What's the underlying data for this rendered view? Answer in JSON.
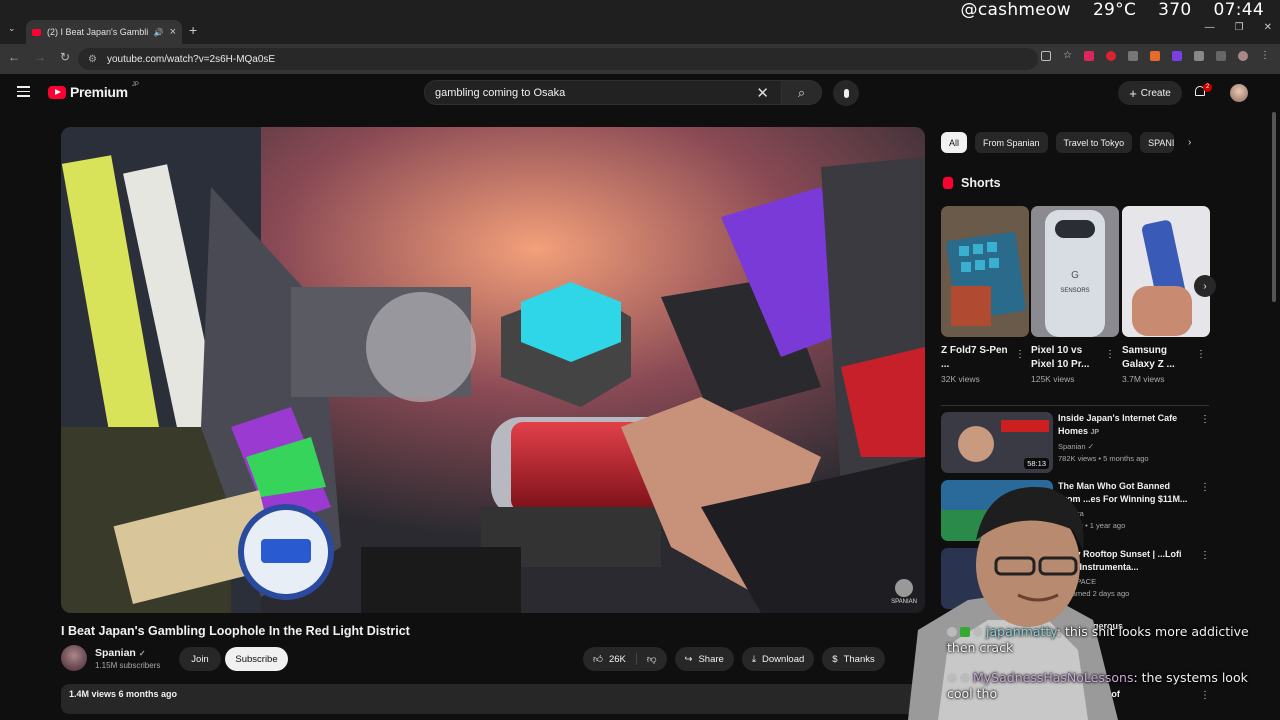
{
  "overlay": {
    "handle": "@cashmeow",
    "temp": "29°C",
    "count": "370",
    "clock": "07:44"
  },
  "browser": {
    "tab_title": "(2) I Beat Japan's Gambling",
    "url": "youtube.com/watch?v=2s6H-MQa0sE"
  },
  "header": {
    "logo_text": "Premium",
    "logo_region": "JP",
    "search_query": "gambling coming to Osaka",
    "create_label": "Create",
    "notif_count": "2"
  },
  "video": {
    "title": "I Beat Japan's Gambling Loophole In the Red Light District",
    "channel": "Spanian",
    "subscribers": "1.15M subscribers",
    "join_label": "Join",
    "subscribe_label": "Subscribe",
    "likes": "26K",
    "share_label": "Share",
    "download_label": "Download",
    "thanks_label": "Thanks",
    "views_date": "1.4M views  6 months ago",
    "watermark": "SPANIAN"
  },
  "sidebar": {
    "chips": [
      "All",
      "From Spanian",
      "Travel to Tokyo",
      "SPANI"
    ],
    "shorts_heading": "Shorts",
    "shorts": [
      {
        "title": "Z Fold7 S-Pen ...",
        "views": "32K views"
      },
      {
        "title": "Pixel 10 vs Pixel 10 Pr...",
        "views": "125K views"
      },
      {
        "title": "Samsung Galaxy Z ...",
        "views": "3.7M views"
      }
    ],
    "recommended": [
      {
        "title": "Inside Japan's Internet Cafe Homes",
        "badge": "JP",
        "channel": "Spanian",
        "meta": "782K views • 5 months ago",
        "duration": "58:13"
      },
      {
        "title": "The Man Who Got Banned From ...es For Winning $11M...",
        "channel": "...ilveira",
        "meta": "...views • 1 year ago",
        "duration": ""
      },
      {
        "title": "...ozy Rooftop Sunset | ...Lofi Jazz Instrumenta...",
        "channel": "...Y SPACE",
        "meta": "Streamed 2 days ago",
        "duration": ""
      },
      {
        "title": "...st Dangerous",
        "channel": "",
        "meta": "...eeks ago",
        "duration": ""
      },
      {
        "title": "...Tech Fails of",
        "channel": "",
        "meta": "",
        "duration": ""
      }
    ]
  },
  "chat": [
    {
      "user": "japanmatty",
      "text": ": this shit looks more addictive then crack"
    },
    {
      "user": "MySadnessHasNoLessons",
      "text": ": the systems look cool tho"
    }
  ]
}
